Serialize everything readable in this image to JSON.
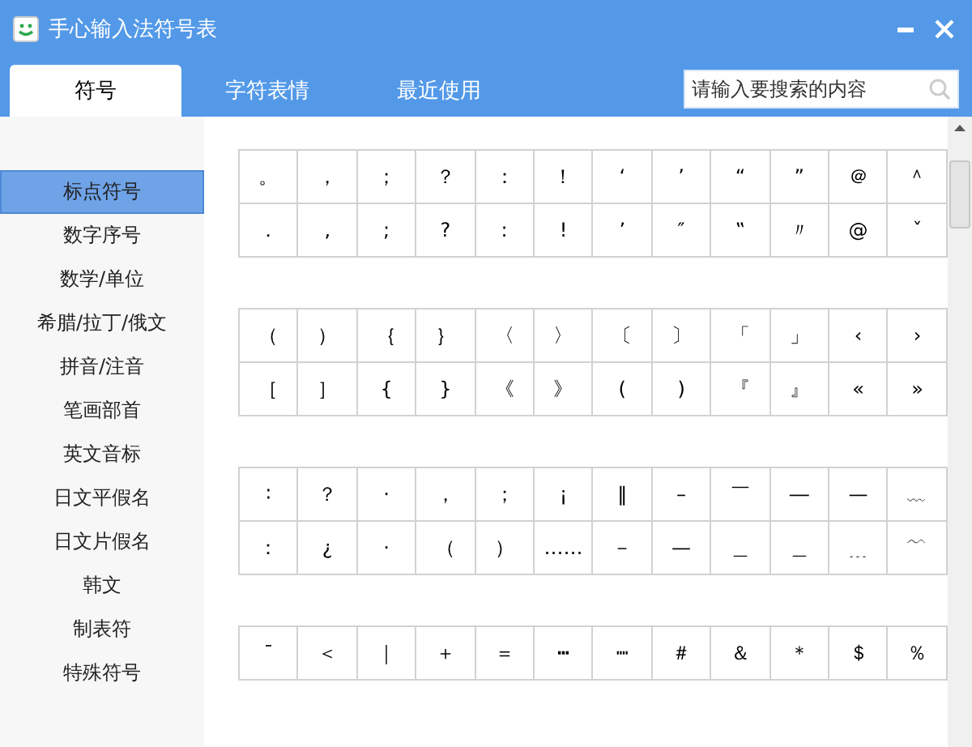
{
  "window": {
    "title": "手心输入法符号表"
  },
  "tabs": [
    {
      "label": "符号",
      "selected": true
    },
    {
      "label": "字符表情",
      "selected": false
    },
    {
      "label": "最近使用",
      "selected": false
    }
  ],
  "search": {
    "placeholder": "请输入要搜索的内容"
  },
  "sidebar": {
    "items": [
      {
        "label": "标点符号",
        "selected": true
      },
      {
        "label": "数字序号",
        "selected": false
      },
      {
        "label": "数学/单位",
        "selected": false
      },
      {
        "label": "希腊/拉丁/俄文",
        "selected": false
      },
      {
        "label": "拼音/注音",
        "selected": false
      },
      {
        "label": "笔画部首",
        "selected": false
      },
      {
        "label": "英文音标",
        "selected": false
      },
      {
        "label": "日文平假名",
        "selected": false
      },
      {
        "label": "日文片假名",
        "selected": false
      },
      {
        "label": "韩文",
        "selected": false
      },
      {
        "label": "制表符",
        "selected": false
      },
      {
        "label": "特殊符号",
        "selected": false
      }
    ]
  },
  "symbol_groups": [
    {
      "rows": [
        [
          "。",
          "，",
          "；",
          "？",
          "：",
          "！",
          "‘",
          "’",
          "“",
          "”",
          "＠",
          "＾"
        ],
        [
          "．",
          ",",
          ";",
          "?",
          ":",
          "!",
          "’",
          "″",
          "‟",
          "〃",
          "@",
          "ˇ"
        ]
      ]
    },
    {
      "rows": [
        [
          "（",
          "）",
          "｛",
          "｝",
          "〈",
          "〉",
          "〔",
          "〕",
          "「",
          "」",
          "‹",
          "›"
        ],
        [
          "［",
          "］",
          "{",
          "}",
          "《",
          "》",
          "(",
          ")",
          "『",
          "』",
          "«",
          "»"
        ]
      ]
    },
    {
      "rows": [
        [
          "∶",
          "？",
          "·",
          "，",
          "；",
          "¡",
          "‖",
          "–",
          "￣",
          "―",
          "—",
          "﹏"
        ],
        [
          "：",
          "¿",
          "·",
          "（",
          "）",
          "……",
          "－",
          "—",
          "＿",
          "＿",
          "﹍",
          "﹋"
        ]
      ]
    },
    {
      "rows": [
        [
          "ˉ",
          "＜",
          "｜",
          "＋",
          "＝",
          "┅",
          "┉",
          "＃",
          "＆",
          "＊",
          "＄",
          "％"
        ]
      ]
    }
  ]
}
